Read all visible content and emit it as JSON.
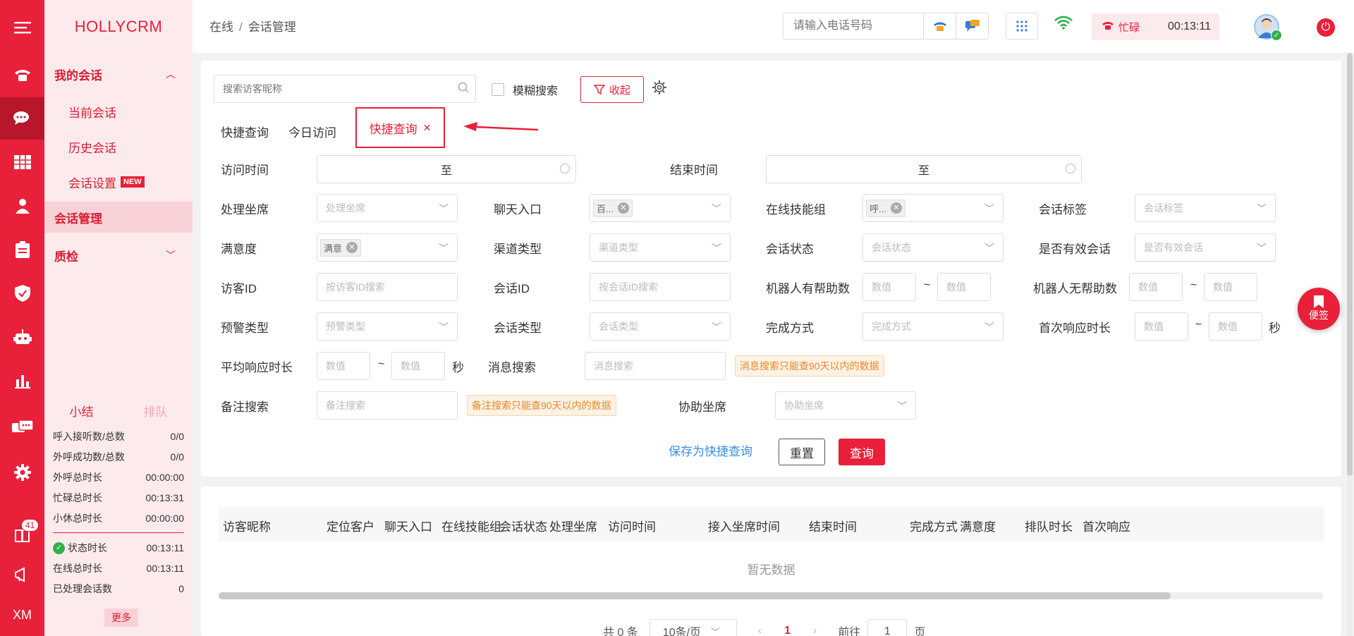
{
  "brand": "HOLLYCRM",
  "rail": {
    "menu_icon": "menu-icon",
    "badge": "41",
    "bottom_label": "XM"
  },
  "menu": {
    "group_my_sessions": "我的会话",
    "current_session": "当前会话",
    "history_session": "历史会话",
    "session_settings": "会话设置",
    "new_tag": "NEW",
    "session_management": "会话管理",
    "quality_check": "质检"
  },
  "stats": {
    "tab_summary": "小结",
    "tab_queue": "排队",
    "rows": [
      {
        "label": "呼入接听数/总数",
        "value": "0/0"
      },
      {
        "label": "外呼成功数/总数",
        "value": "0/0"
      },
      {
        "label": "外呼总时长",
        "value": "00:00:00"
      },
      {
        "label": "忙碌总时长",
        "value": "00:13:31"
      },
      {
        "label": "小休总时长",
        "value": "00:00:00"
      }
    ],
    "rows2": [
      {
        "label": "状态时长",
        "value": "00:13:11"
      },
      {
        "label": "在线总时长",
        "value": "00:13:11"
      },
      {
        "label": "已处理会话数",
        "value": "0"
      }
    ],
    "more": "更多"
  },
  "topbar": {
    "breadcrumb_1": "在线",
    "breadcrumb_sep": "/",
    "breadcrumb_2": "会话管理",
    "phone_placeholder": "请输入电话号码",
    "status": "忙碌",
    "timer": "00:13:11"
  },
  "filters": {
    "search_placeholder": "搜索访客昵称",
    "fuzzy": "模糊搜索",
    "collapse": "收起",
    "tab_quick": "快捷查询",
    "tab_today": "今日访问",
    "tab_quick_active": "快捷查询",
    "visit_time": "访问时间",
    "end_time": "结束时间",
    "to": "至",
    "agent": "处理坐席",
    "agent_ph": "处理坐席",
    "chat_entry": "聊天入口",
    "chat_entry_chip": "百...",
    "skill_group": "在线技能组",
    "skill_group_chip": "呼...",
    "session_tag": "会话标签",
    "session_tag_ph": "会话标签",
    "satisfaction": "满意度",
    "satisfaction_chip": "满意",
    "channel_type": "渠道类型",
    "channel_type_ph": "渠道类型",
    "session_status": "会话状态",
    "session_status_ph": "会话状态",
    "valid_session": "是否有效会话",
    "valid_session_ph": "是否有效会话",
    "visitor_id": "访客ID",
    "visitor_id_ph": "按访客ID搜索",
    "session_id": "会话ID",
    "session_id_ph": "按会话ID搜索",
    "robot_helpful": "机器人有帮助数",
    "robot_unhelpful": "机器人无帮助数",
    "num_ph": "数值",
    "tilde": "~",
    "warn_type": "预警类型",
    "warn_type_ph": "预警类型",
    "session_type": "会话类型",
    "session_type_ph": "会话类型",
    "finish_method": "完成方式",
    "finish_method_ph": "完成方式",
    "first_resp": "首次响应时长",
    "sec": "秒",
    "avg_resp": "平均响应时长",
    "msg_search": "消息搜索",
    "msg_search_ph": "消息搜索",
    "msg_warn": "消息搜索只能查90天以内的数据",
    "note_search": "备注搜索",
    "note_search_ph": "备注搜索",
    "note_warn": "备注搜索只能查90天以内的数据",
    "assist_agent": "协助坐席",
    "assist_agent_ph": "协助坐席",
    "save_quick": "保存为快捷查询",
    "reset": "重置",
    "query": "查询"
  },
  "table": {
    "columns": [
      "访客昵称",
      "定位客户",
      "聊天入口",
      "在线技能组",
      "会话状态",
      "处理坐席",
      "访问时间",
      "接入坐席时间",
      "结束时间",
      "完成方式",
      "满意度",
      "排队时长",
      "首次响应"
    ],
    "empty": "暂无数据",
    "total": "共 0 条",
    "page_size": "10条/页",
    "current_page": "1",
    "goto": "前往",
    "goto_value": "1",
    "page_unit": "页"
  },
  "sticky_note": "便签"
}
